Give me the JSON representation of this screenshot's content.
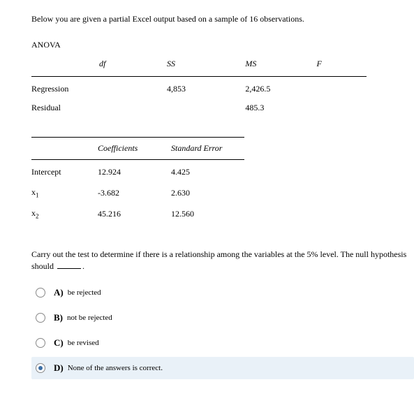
{
  "intro": "Below you are given a partial Excel output based on a sample of 16 observations.",
  "anova": {
    "title": "ANOVA",
    "headers": {
      "df": "df",
      "ss": "SS",
      "ms": "MS",
      "f": "F"
    },
    "rows": [
      {
        "label": "Regression",
        "df": "",
        "ss": "4,853",
        "ms": "2,426.5",
        "f": ""
      },
      {
        "label": "Residual",
        "df": "",
        "ss": "",
        "ms": "485.3",
        "f": ""
      }
    ]
  },
  "coef": {
    "headers": {
      "coef": "Coefficients",
      "se": "Standard Error"
    },
    "rows": [
      {
        "label": "Intercept",
        "coef": "12.924",
        "se": "4.425"
      },
      {
        "label_base": "x",
        "label_sub": "1",
        "coef": "-3.682",
        "se": "2.630"
      },
      {
        "label_base": "x",
        "label_sub": "2",
        "coef": "45.216",
        "se": "12.560"
      }
    ]
  },
  "question": "Carry out the test to determine if there is a relationship among the variables at the 5% level. The null hypothesis should ",
  "options": [
    {
      "letter": "A)",
      "text": "be rejected",
      "selected": false
    },
    {
      "letter": "B)",
      "text": "not be rejected",
      "selected": false
    },
    {
      "letter": "C)",
      "text": "be revised",
      "selected": false
    },
    {
      "letter": "D)",
      "text": "None of the answers is correct.",
      "selected": true
    }
  ]
}
